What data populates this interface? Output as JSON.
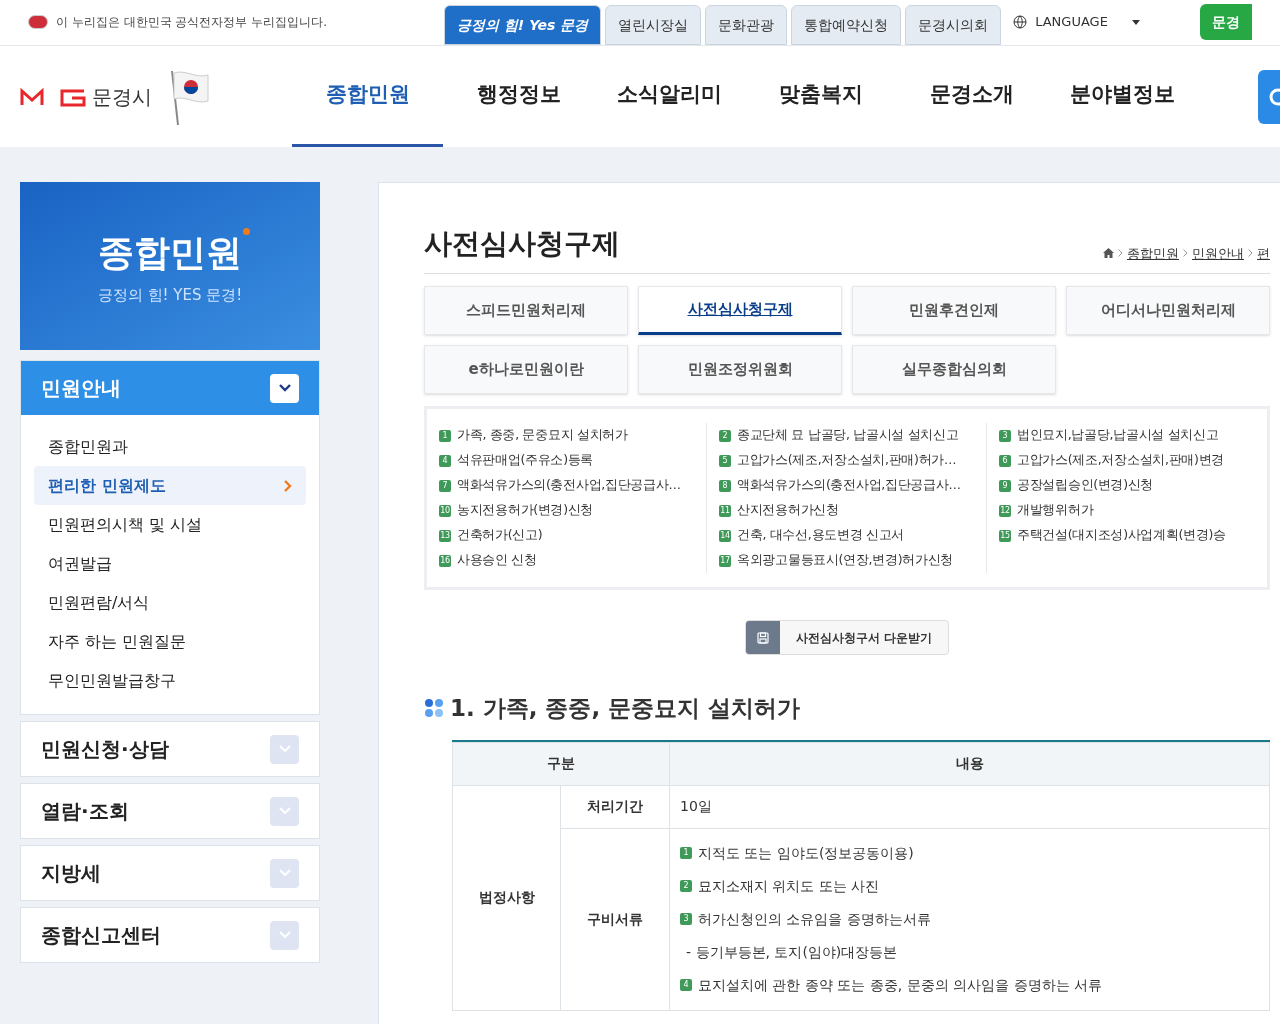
{
  "top_bar": {
    "notice": "이 누리집은 대한민국 공식전자정부 누리집입니다.",
    "site_tabs": [
      {
        "label": "긍정의 힘! Yes 문경",
        "selected": true
      },
      {
        "label": "열린시장실",
        "selected": false
      },
      {
        "label": "문화관광",
        "selected": false
      },
      {
        "label": "통합예약신청",
        "selected": false
      },
      {
        "label": "문경시의회",
        "selected": false
      }
    ],
    "language": "LANGUAGE",
    "badge": "문경"
  },
  "header": {
    "logo_text": "문경시",
    "nav": [
      {
        "label": "종합민원",
        "selected": true
      },
      {
        "label": "행정정보",
        "selected": false
      },
      {
        "label": "소식알리미",
        "selected": false
      },
      {
        "label": "맞춤복지",
        "selected": false
      },
      {
        "label": "문경소개",
        "selected": false
      },
      {
        "label": "분야별정보",
        "selected": false
      }
    ]
  },
  "sidebar": {
    "title": "종합민원",
    "subtitle": "긍정의 힘! YES 문경!",
    "menus": [
      {
        "label": "민원안내",
        "expanded": true,
        "items": [
          {
            "label": "종합민원과",
            "selected": false
          },
          {
            "label": "편리한 민원제도",
            "selected": true
          },
          {
            "label": "민원편의시책 및 시설",
            "selected": false
          },
          {
            "label": "여권발급",
            "selected": false
          },
          {
            "label": "민원편람/서식",
            "selected": false
          },
          {
            "label": "자주 하는 민원질문",
            "selected": false
          },
          {
            "label": "무인민원발급창구",
            "selected": false
          }
        ]
      },
      {
        "label": "민원신청·상담",
        "expanded": false
      },
      {
        "label": "열람·조회",
        "expanded": false
      },
      {
        "label": "지방세",
        "expanded": false
      },
      {
        "label": "종합신고센터",
        "expanded": false
      }
    ]
  },
  "content": {
    "title": "사전심사청구제",
    "breadcrumb": [
      "종합민원",
      "민원안내",
      "편"
    ],
    "tabs": [
      {
        "label": "스피드민원처리제",
        "selected": false
      },
      {
        "label": "사전심사청구제",
        "selected": true
      },
      {
        "label": "민원후견인제",
        "selected": false
      },
      {
        "label": "어디서나민원처리제",
        "selected": false
      },
      {
        "label": "e하나로민원이란",
        "selected": false
      },
      {
        "label": "민원조정위원회",
        "selected": false
      },
      {
        "label": "실무종합심의회",
        "selected": false
      }
    ],
    "list_columns": [
      [
        {
          "num": "1",
          "text": "가족, 종중, 문중묘지 설치허가"
        },
        {
          "num": "4",
          "text": "석유판매업(주유소)등록"
        },
        {
          "num": "7",
          "text": "액화석유가스의(충전사업,집단공급사…"
        },
        {
          "num": "10",
          "text": "농지전용허가(변경)신청"
        },
        {
          "num": "13",
          "text": "건축허가(신고)"
        },
        {
          "num": "16",
          "text": "사용승인 신청"
        }
      ],
      [
        {
          "num": "2",
          "text": "종교단체 묘 납골당, 납골시설 설치신고"
        },
        {
          "num": "5",
          "text": "고압가스(제조,저장소설치,판매)허가…"
        },
        {
          "num": "8",
          "text": "액화석유가스의(충전사업,집단공급사…"
        },
        {
          "num": "11",
          "text": "산지전용허가신청"
        },
        {
          "num": "14",
          "text": "건축, 대수선,용도변경 신고서"
        },
        {
          "num": "17",
          "text": "옥외광고물등표시(연장,변경)허가신청"
        }
      ],
      [
        {
          "num": "3",
          "text": "법인묘지,납골당,납골시설 설치신고"
        },
        {
          "num": "6",
          "text": "고압가스(제조,저장소설치,판매)변경"
        },
        {
          "num": "9",
          "text": "공장설립승인(변경)신청"
        },
        {
          "num": "12",
          "text": "개발행위허가"
        },
        {
          "num": "15",
          "text": "주택건설(대지조성)사업계획(변경)승"
        }
      ]
    ],
    "download_button": "사전심사청구서 다운받기",
    "section_title": "1. 가족, 종중, 문중묘지 설치허가",
    "table": {
      "columns": [
        "구분",
        "내용"
      ],
      "group": "법정사항",
      "rows": [
        {
          "label": "처리기간",
          "value": "10일"
        },
        {
          "label": "구비서류",
          "docs": [
            {
              "num": "1",
              "text": "지적도 또는 임야도(정보공동이용)"
            },
            {
              "num": "2",
              "text": "묘지소재지 위치도 또는 사진"
            },
            {
              "num": "3",
              "text": "허가신청인의 소유임을 증명하는서류"
            },
            {
              "text": "- 등기부등본, 토지(임야)대장등본"
            },
            {
              "num": "4",
              "text": "묘지설치에 관한 종약 또는 종중, 문중의 의사임을 증명하는 서류"
            }
          ]
        }
      ]
    }
  }
}
